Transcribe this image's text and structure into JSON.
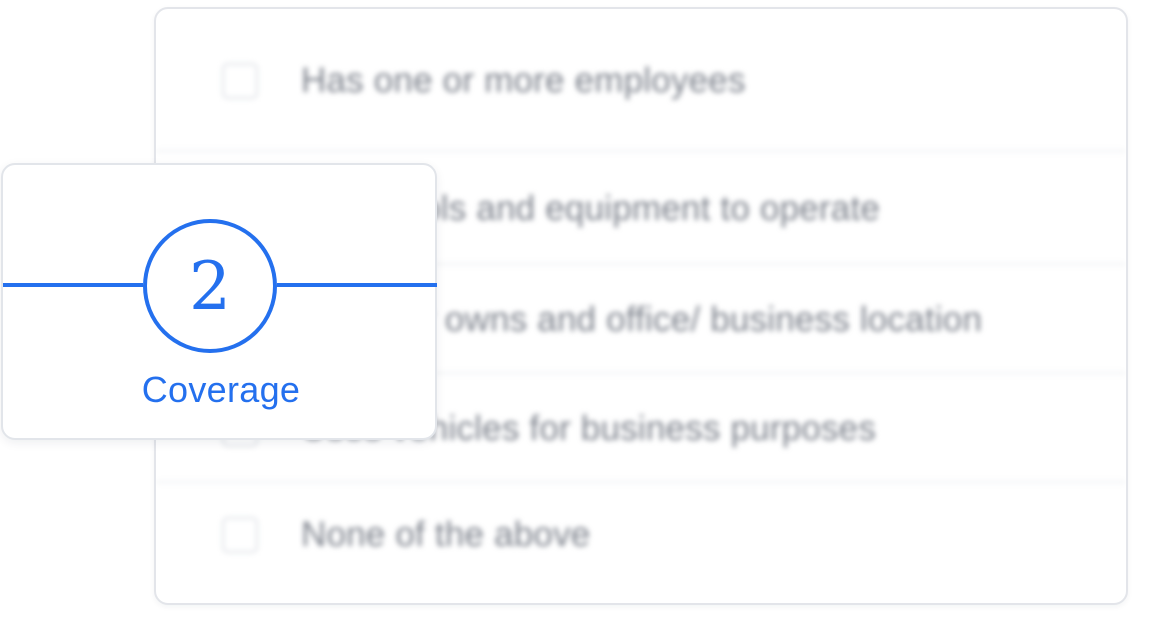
{
  "checklist": {
    "options": [
      {
        "label": "Has one or more employees",
        "checked": false
      },
      {
        "label": "Uses tools and equipment to operate",
        "checked": false
      },
      {
        "label": "Rents or owns and office/ business location",
        "checked": false
      },
      {
        "label": "Uses vehicles for business purposes",
        "checked": false
      },
      {
        "label": "None of the above",
        "checked": false
      }
    ]
  },
  "step": {
    "number": "2",
    "title": "Coverage"
  },
  "colors": {
    "accent": "#2470ee",
    "muted_text": "#7c818b",
    "border": "#e2e5ea"
  }
}
